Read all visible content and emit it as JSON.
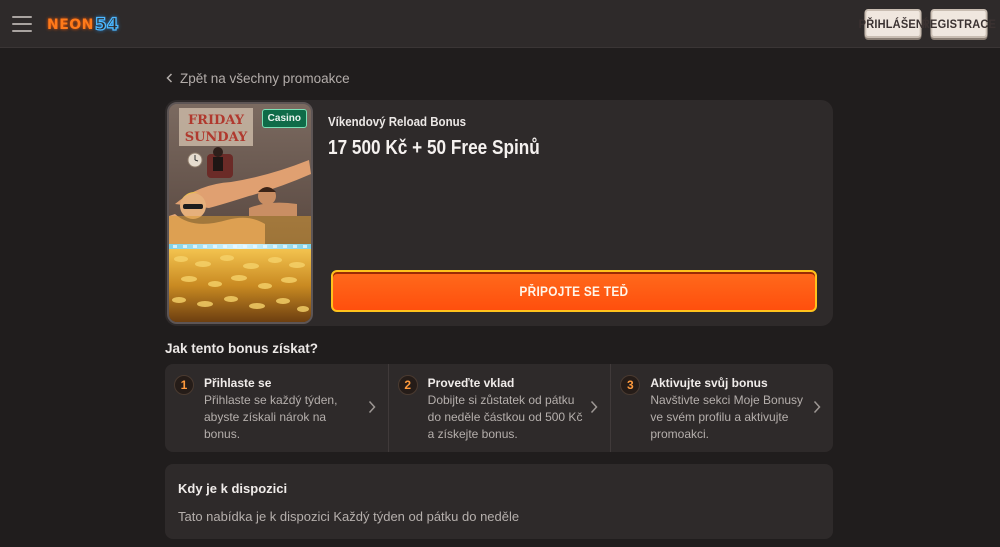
{
  "header": {
    "logo_text": "NEON",
    "logo_number": "54",
    "login_label": "PŘIHLÁŠENÍ",
    "register_label": "REGISTRACE"
  },
  "back_link": "Zpět na všechny promoakce",
  "promo": {
    "badge": "Casino",
    "subtitle": "Víkendový Reload Bonus",
    "title": "17 500 Kč + 50 Free Spinů",
    "cta_label": "PŘIPOJTE SE TEĎ",
    "image_lettering": [
      "FRIDAY",
      "SUNDAY"
    ]
  },
  "how": {
    "title": "Jak tento bonus získat?",
    "steps": [
      {
        "num": "1",
        "title": "Přihlaste se",
        "desc": "Přihlaste se každý týden, abyste získali nárok na bonus."
      },
      {
        "num": "2",
        "title": "Proveďte vklad",
        "desc": "Dobijte si zůstatek od pátku do neděle částkou od 500 Kč a získejte bonus."
      },
      {
        "num": "3",
        "title": "Aktivujte svůj bonus",
        "desc": "Navštivte sekci Moje Bonusy ve svém profilu a aktivujte promoakci."
      }
    ]
  },
  "availability": {
    "title": "Kdy je k dispozici",
    "text": "Tato nabídka je k dispozici Každý týden od pátku do neděle"
  },
  "colors": {
    "background": "#201d1d",
    "card": "#2e2a2a",
    "accent_orange": "#ff5a12",
    "cta_border": "#ffc21c",
    "badge_green": "#0f6b48",
    "logo_blue": "#4db8ff"
  },
  "icons": [
    "menu-icon",
    "chevron-left-icon",
    "chevron-right-icon"
  ]
}
